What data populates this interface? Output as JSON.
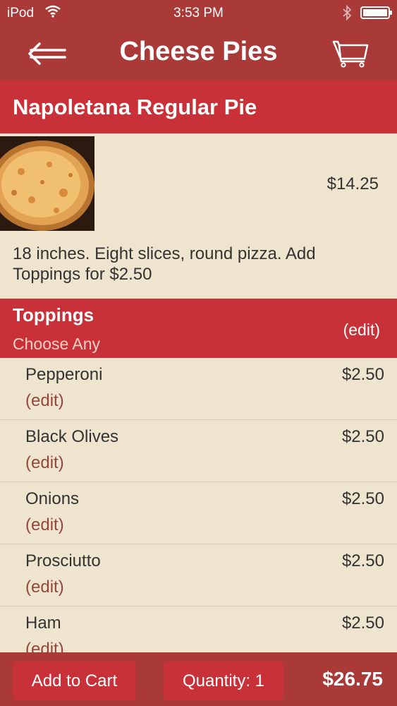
{
  "status_bar": {
    "carrier": "iPod",
    "time": "3:53 PM"
  },
  "nav": {
    "title": "Cheese Pies",
    "back_icon": "back-arrow-icon",
    "cart_icon": "cart-icon"
  },
  "item": {
    "name": "Napoletana Regular Pie",
    "price": "$14.25",
    "description": "18 inches. Eight slices, round pizza. Add Toppings for $2.50"
  },
  "toppings": {
    "label": "Toppings",
    "subtitle": "Choose Any",
    "edit_label": "(edit)",
    "items": [
      {
        "name": "Pepperoni",
        "price": "$2.50",
        "edit": "(edit)"
      },
      {
        "name": "Black Olives",
        "price": "$2.50",
        "edit": "(edit)"
      },
      {
        "name": "Onions",
        "price": "$2.50",
        "edit": "(edit)"
      },
      {
        "name": "Prosciutto",
        "price": "$2.50",
        "edit": "(edit)"
      },
      {
        "name": "Ham",
        "price": "$2.50",
        "edit": "(edit)"
      }
    ]
  },
  "bottom_bar": {
    "add_to_cart": "Add to Cart",
    "quantity": "Quantity: 1",
    "total": "$26.75"
  },
  "colors": {
    "bar": "#a93a38",
    "accent": "#c83137",
    "background": "#efe4cd",
    "edit_text": "#97463e"
  }
}
